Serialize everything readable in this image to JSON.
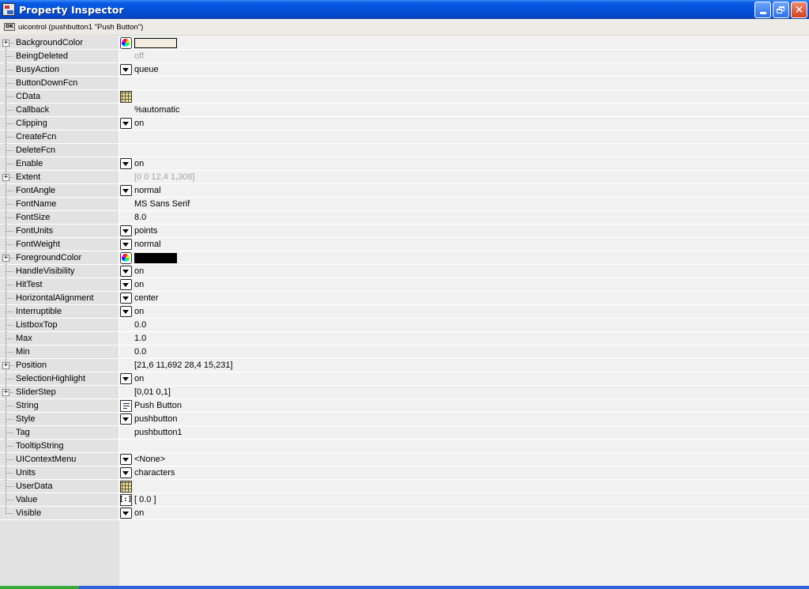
{
  "window": {
    "title": "Property Inspector",
    "object_label": "uicontrol (pushbutton1 \"Push Button\")",
    "ok_icon_text": "OK",
    "minimize_icon": "minimize-icon",
    "maximize_icon": "restore-icon",
    "close_label": "✕"
  },
  "colors": {
    "titlebar": "#0450d8",
    "name_column": "#e2e2e2",
    "value_column": "#f1f1f1"
  },
  "properties": [
    {
      "name": "BackgroundColor",
      "control": "color",
      "swatch": "#f0ece0",
      "value": "",
      "expand": true
    },
    {
      "name": "BeingDeleted",
      "control": "none",
      "value": "off",
      "grey": true
    },
    {
      "name": "BusyAction",
      "control": "dropdown",
      "value": "queue"
    },
    {
      "name": "ButtonDownFcn",
      "control": "none",
      "value": ""
    },
    {
      "name": "CData",
      "control": "table",
      "value": ""
    },
    {
      "name": "Callback",
      "control": "none",
      "value": "%automatic"
    },
    {
      "name": "Clipping",
      "control": "dropdown",
      "value": "on"
    },
    {
      "name": "CreateFcn",
      "control": "none",
      "value": ""
    },
    {
      "name": "DeleteFcn",
      "control": "none",
      "value": ""
    },
    {
      "name": "Enable",
      "control": "dropdown",
      "value": "on"
    },
    {
      "name": "Extent",
      "control": "none",
      "value": "[0 0 12,4 1,308]",
      "grey": true,
      "expand": true
    },
    {
      "name": "FontAngle",
      "control": "dropdown",
      "value": "normal"
    },
    {
      "name": "FontName",
      "control": "none",
      "value": "MS Sans Serif"
    },
    {
      "name": "FontSize",
      "control": "none",
      "value": "8.0"
    },
    {
      "name": "FontUnits",
      "control": "dropdown",
      "value": "points"
    },
    {
      "name": "FontWeight",
      "control": "dropdown",
      "value": "normal"
    },
    {
      "name": "ForegroundColor",
      "control": "color",
      "swatch": "#000000",
      "value": "",
      "expand": true
    },
    {
      "name": "HandleVisibility",
      "control": "dropdown",
      "value": "on"
    },
    {
      "name": "HitTest",
      "control": "dropdown",
      "value": "on"
    },
    {
      "name": "HorizontalAlignment",
      "control": "dropdown",
      "value": "center"
    },
    {
      "name": "Interruptible",
      "control": "dropdown",
      "value": "on"
    },
    {
      "name": "ListboxTop",
      "control": "none",
      "value": "0.0"
    },
    {
      "name": "Max",
      "control": "none",
      "value": "1.0"
    },
    {
      "name": "Min",
      "control": "none",
      "value": "0.0"
    },
    {
      "name": "Position",
      "control": "none",
      "value": "[21,6 11,692 28,4 15,231]",
      "expand": true
    },
    {
      "name": "SelectionHighlight",
      "control": "dropdown",
      "value": "on"
    },
    {
      "name": "SliderStep",
      "control": "none",
      "value": "[0,01 0,1]",
      "expand": true
    },
    {
      "name": "String",
      "control": "text",
      "value": "Push Button"
    },
    {
      "name": "Style",
      "control": "dropdown",
      "value": "pushbutton"
    },
    {
      "name": "Tag",
      "control": "none",
      "value": "pushbutton1"
    },
    {
      "name": "TooltipString",
      "control": "none",
      "value": ""
    },
    {
      "name": "UIContextMenu",
      "control": "dropdown",
      "value": "<None>"
    },
    {
      "name": "Units",
      "control": "dropdown",
      "value": "characters"
    },
    {
      "name": "UserData",
      "control": "table",
      "value": ""
    },
    {
      "name": "Value",
      "control": "vector",
      "value": "[ 0.0 ]"
    },
    {
      "name": "Visible",
      "control": "dropdown",
      "value": "on"
    }
  ]
}
